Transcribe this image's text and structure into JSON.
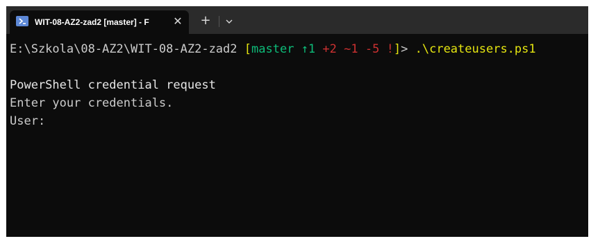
{
  "tab": {
    "title": "WIT-08-AZ2-zad2 [master] - F",
    "close_glyph": "✕",
    "new_tab_glyph": "+",
    "dropdown_icon": "chevron-down-icon",
    "app_icon": "powershell-icon"
  },
  "prompt": {
    "path": "E:\\Szkola\\08-AZ2\\WIT-08-AZ2-zad2",
    "open_bracket": "[",
    "branch": "master",
    "ahead": "↑1",
    "added": "+2",
    "modified": "~1",
    "deleted": "-5",
    "bang": "!",
    "close_bracket": "]",
    "gt": ">",
    "command": ".\\createusers.ps1"
  },
  "output": {
    "line1": "PowerShell credential request",
    "line2": "Enter your credentials.",
    "line3": "User:"
  },
  "colors": {
    "background": "#0c0c0c",
    "titlebar": "#2b2b2b",
    "git_bracket": "#e5e510",
    "git_branch": "#0dbc79",
    "git_changes": "#cd3131",
    "command": "#e5e510"
  }
}
